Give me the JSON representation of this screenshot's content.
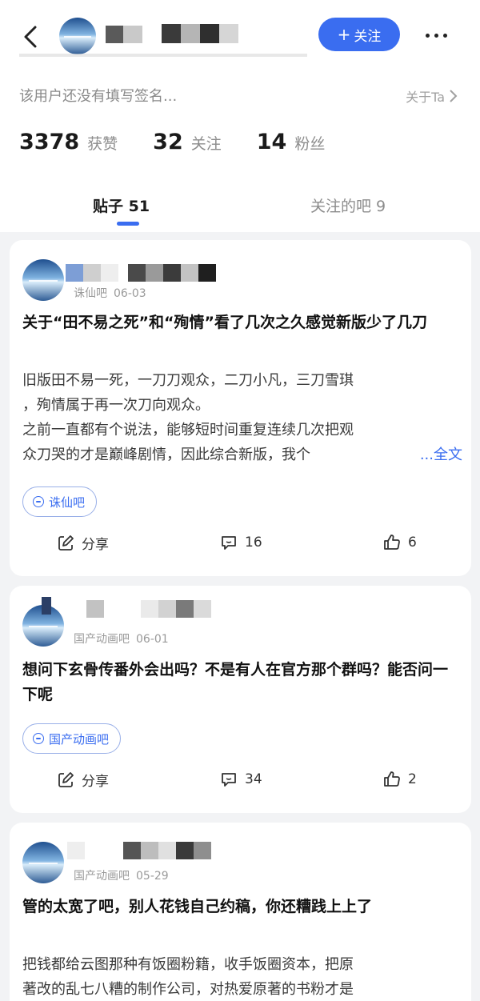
{
  "header": {
    "follow_label": "关注",
    "signature": "该用户还没有填写签名...",
    "about_label": "关于Ta"
  },
  "stats": [
    {
      "value": "3378",
      "label": "获赞"
    },
    {
      "value": "32",
      "label": "关注"
    },
    {
      "value": "14",
      "label": "粉丝"
    }
  ],
  "tabs": [
    {
      "label": "贴子 51"
    },
    {
      "label": "关注的吧 9"
    }
  ],
  "colors": {
    "accent": "#3a6df0",
    "background": "#f2f3f5"
  },
  "posts": [
    {
      "forum": "诛仙吧",
      "date": "06-03",
      "title": "关于“田不易之死”和“殉情”看了几次之久感觉新版少了几刀",
      "body_lines": [
        "旧版田不易一死，一刀刀观众，二刀小凡，三刀雪琪",
        "，殉情属于再一次刀向观众。",
        "之前一直都有个说法，能够短时间重复连续几次把观",
        "众刀哭的才是巅峰剧情，因此综合新版，我个"
      ],
      "more_label": "...全文",
      "tag": "诛仙吧",
      "share_label": "分享",
      "comments": "16",
      "likes": "6"
    },
    {
      "forum": "国产动画吧",
      "date": "06-01",
      "title": "想问下玄骨传番外会出吗？不是有人在官方那个群吗？能否问一下呢",
      "tag": "国产动画吧",
      "share_label": "分享",
      "comments": "34",
      "likes": "2"
    },
    {
      "forum": "国产动画吧",
      "date": "05-29",
      "title": "管的太宽了吧，别人花钱自己约稿，你还糟践上上了",
      "body_lines": [
        "把钱都给云图那种有饭圈粉籍，收手饭圈资本，把原",
        "著改的乱七八糟的制作公司，对热爱原著的书粉才是"
      ]
    }
  ]
}
